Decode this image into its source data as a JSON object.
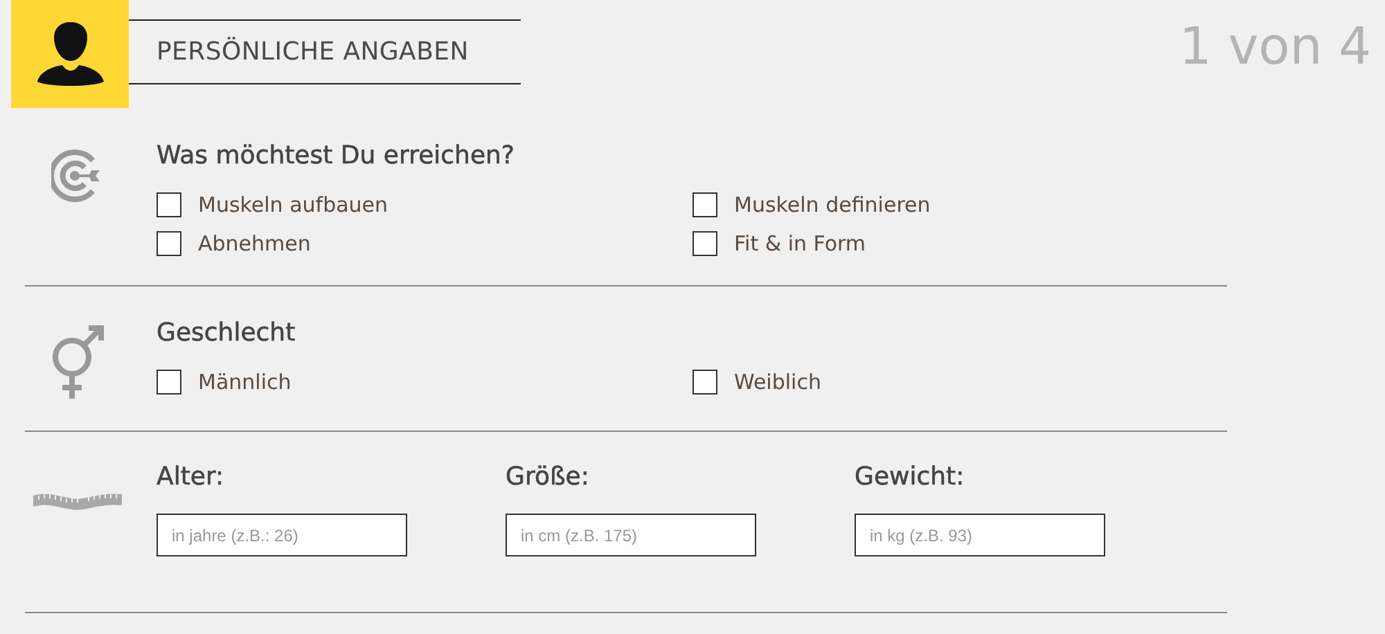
{
  "header": {
    "title": "PERSÖNLICHE ANGABEN",
    "step": "1 von 4"
  },
  "sections": [
    {
      "kind": "checkboxes",
      "heading": "Was möchtest Du erreichen?",
      "options": [
        {
          "label": "Muskeln aufbauen",
          "checked": false
        },
        {
          "label": "Muskeln definieren",
          "checked": false
        },
        {
          "label": "Abnehmen",
          "checked": false
        },
        {
          "label": "Fit & in Form",
          "checked": false
        }
      ]
    },
    {
      "kind": "checkboxes",
      "heading": "Geschlecht",
      "options": [
        {
          "label": "Männlich",
          "checked": false
        },
        {
          "label": "Weiblich",
          "checked": false
        }
      ]
    },
    {
      "kind": "fields",
      "fields": [
        {
          "label": "Alter:",
          "placeholder": "in jahre (z.B.: 26)"
        },
        {
          "label": "Größe:",
          "placeholder": "in cm (z.B. 175)"
        },
        {
          "label": "Gewicht:",
          "placeholder": "in kg (z.B. 93)"
        }
      ]
    }
  ]
}
